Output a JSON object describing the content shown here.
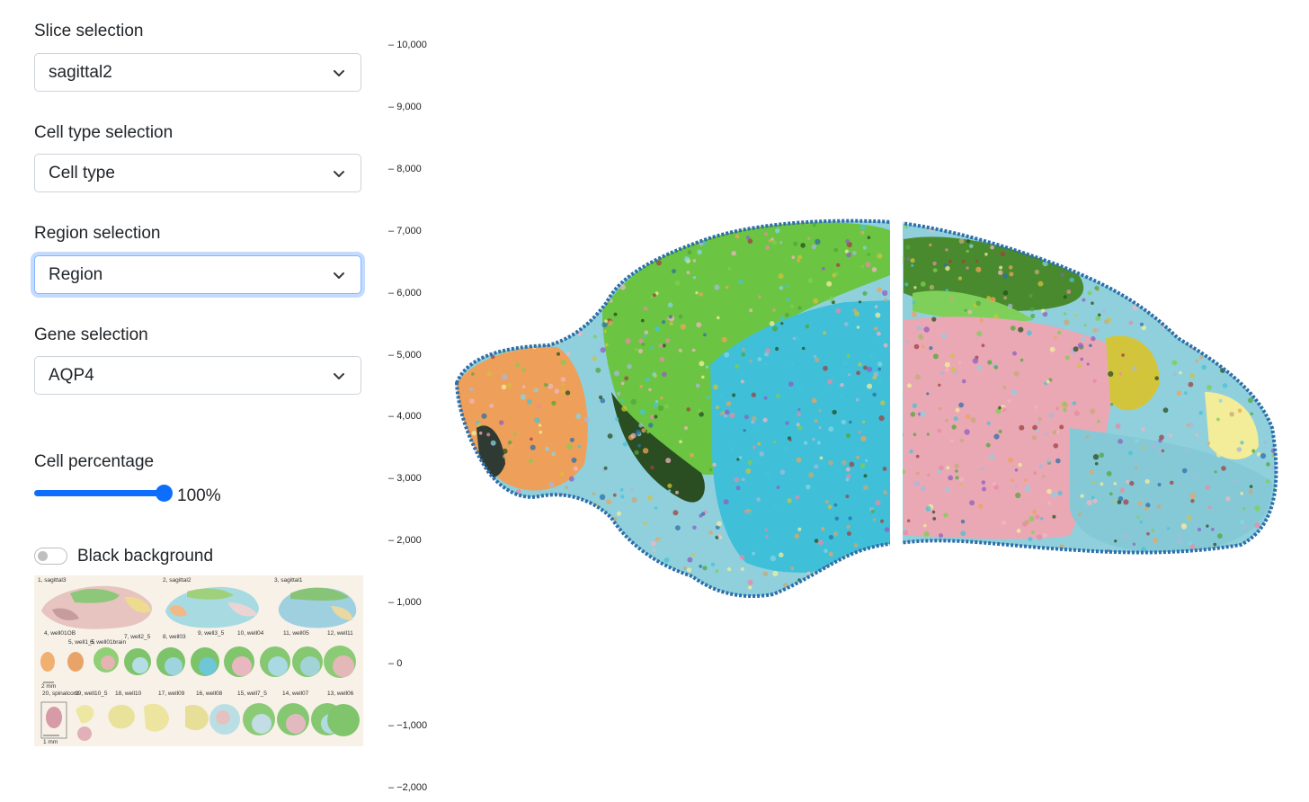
{
  "sidebar": {
    "slice": {
      "label": "Slice selection",
      "value": "sagittal2"
    },
    "cell_type": {
      "label": "Cell type selection",
      "value": "Cell type"
    },
    "region": {
      "label": "Region selection",
      "value": "Region"
    },
    "gene": {
      "label": "Gene selection",
      "value": "AQP4"
    },
    "cell_percentage": {
      "label": "Cell percentage",
      "value_text": "100%",
      "value": 100
    },
    "black_background": {
      "label": "Black background",
      "checked": false
    }
  },
  "thumbnails": {
    "labels": [
      "1, sagittal3",
      "2, sagittal2",
      "3, sagittal1",
      "4, well01OB",
      "5, well1_5",
      "6, well01brain",
      "7, well2_5",
      "8, well03",
      "9, well3_5",
      "10, well04",
      "11, well05",
      "12, well11",
      "20, spinalcord",
      "19, well10_5",
      "18, well10",
      "17, well09",
      "16, well08",
      "15, well7_5",
      "14, well07",
      "13, well06"
    ],
    "scale_labels": [
      "2 mm",
      "1 mm"
    ]
  },
  "y_axis": {
    "ticks": [
      "10,000",
      "9,000",
      "8,000",
      "7,000",
      "6,000",
      "5,000",
      "4,000",
      "3,000",
      "2,000",
      "1,000",
      "0",
      "−1,000",
      "−2,000"
    ]
  },
  "colors": {
    "accent": "#0d6efd",
    "palette": [
      "#45c3d9",
      "#86d4e4",
      "#f2b5c0",
      "#e98aa5",
      "#7ecf4f",
      "#4fa83a",
      "#274d1f",
      "#f1a25a",
      "#2d6faa",
      "#d2c23c",
      "#f4ee9b",
      "#a8b8dc",
      "#8f5fc3",
      "#c8a87a",
      "#a04040"
    ]
  }
}
